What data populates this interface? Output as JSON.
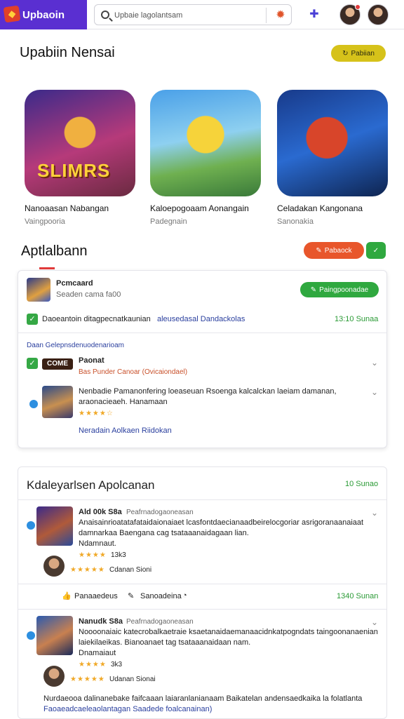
{
  "header": {
    "logo_text": "Upbaoin",
    "search_placeholder": "Upbaie lagolantsam",
    "icons": [
      "search-icon",
      "gear-icon",
      "puzzle-icon"
    ]
  },
  "featured": {
    "title": "Upabiin Nensai",
    "action_label": "Pabiian",
    "games": [
      {
        "name": "Nanoaasan Nabangan",
        "sub": "Vaingpooria",
        "banner": "SLIMRS"
      },
      {
        "name": "Kaloepogoaam Aonangain",
        "sub": "Padegnain",
        "banner": ""
      },
      {
        "name": "Celadakan Kangonana",
        "sub": "Sanonakia",
        "banner": ""
      }
    ]
  },
  "apps": {
    "title": "Aptlalbann",
    "action_label": "Pabaock",
    "app_name": "Pcmcaard",
    "app_sub": "Seaden cama fa00",
    "install_label": "Paingpoonadae",
    "verified_text": "Daoeantoin ditagpecnatkaunian",
    "verified_link": "aleusedasal Dandackolas",
    "verified_time": "13:10 Sunaa",
    "link_section": "Daan Gelepnsdenuodenarioam",
    "item1_tag": "COME",
    "item1_title": "Paonat",
    "item1_sub": "Bas Punder Canoar (Ovicaiondael)",
    "item2_line1": "Nenbadie Pamanonfering loeaseuan Rsoenga kalcalckan laeiam damanan,",
    "item2_line2": "araonacieaeh. Hanamaan",
    "item2_link": "Neradain Aolkaen Riidokan"
  },
  "reviews": {
    "title": "Kdaleyarlsen Apolcanan",
    "count_label": "10 Sunao",
    "items": [
      {
        "name": "Ald 00k S8a",
        "tag": "Peafrnadogaoneasan",
        "text1": "Anaisainrioatatafataidaionaiaet lcasfontdaecianaadbeirelocgoriar asrigoranaanaiaat",
        "text2": "damnarkaa Baengana cag tsataaanaidagaan lian.",
        "text3": "Ndamnaut.",
        "rating": "13k3",
        "reviewer_stars": "Cdanan Sioni"
      },
      {
        "name": "Nanudk S8a",
        "tag": "Peafrnadogaoneasan",
        "text1": "Noooonaiaic katecrobalkaetraie ksaetanaidaemanaacidnkatpogndats taingoonanaenian",
        "text2": "laiekilaeikas. Bianoanaet tag tsataaanaidaan nam.",
        "text3": "Dnamaiaut",
        "rating": "3k3",
        "reviewer_stars": "Udanan Sionai"
      }
    ],
    "footer_left": "Panaaedeus",
    "footer_mid": "Sanoadeina",
    "footer_time": "1340 Sunan",
    "bottom_line1": "Nurdaeooa dalinanebake faifcaaan laiaranlanianaam Baikatelan andensaedkaika la folatlanta",
    "bottom_line2": "Faoaeadcaeleaolantagan Saadede foalcanainan)"
  },
  "colors": {
    "brand": "#5a2fd1",
    "accent_green": "#2fa83f",
    "accent_orange": "#e8562b",
    "accent_yellow": "#d6c21a"
  }
}
